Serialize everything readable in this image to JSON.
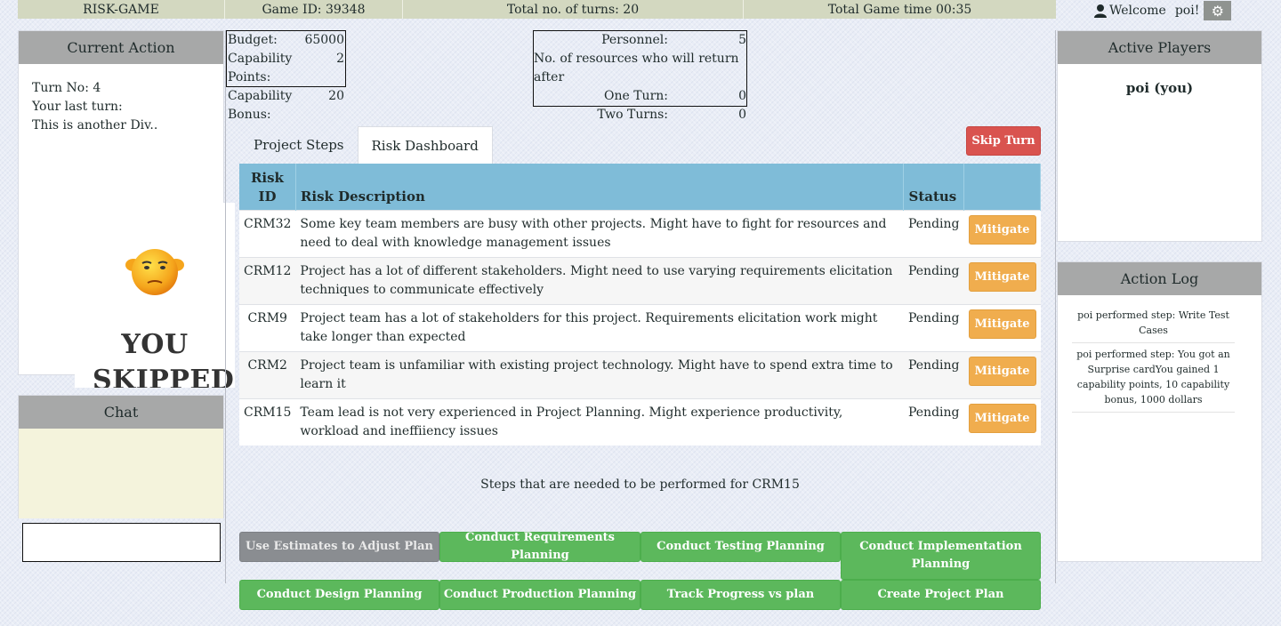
{
  "topbar": {
    "game_name": "RISK-GAME",
    "game_id": "Game ID: 39348",
    "turns": "Total no. of turns: 20",
    "time": "Total Game time 00:35"
  },
  "user": {
    "welcome": "Welcome",
    "name": "poi!"
  },
  "budget": {
    "budget_label": "Budget:",
    "budget_value": "65000",
    "cap_points_label": "Capability Points:",
    "cap_points_value": "2",
    "cap_bonus_label": "Capability Bonus:",
    "cap_bonus_value": "20"
  },
  "personnel": {
    "personnel_label": "Personnel:",
    "personnel_value": "5",
    "return_label": "No. of resources who will return after",
    "one_turn_label": "One Turn:",
    "one_turn_value": "0",
    "two_turns_label": "Two Turns:",
    "two_turns_value": "0"
  },
  "current_action": {
    "title": "Current Action",
    "turn_no": "Turn No: 4",
    "last_turn": "Your last turn:",
    "another_div": "This is another Div..",
    "skipped_line1": "YOU",
    "skipped_line2": "SKIPPED"
  },
  "chat": {
    "title": "Chat"
  },
  "tabs": {
    "project_steps": "Project Steps",
    "risk_dashboard": "Risk Dashboard",
    "skip_turn": "Skip Turn"
  },
  "table": {
    "col_id": "Risk ID",
    "col_desc": "Risk Description",
    "col_status": "Status",
    "rows": [
      {
        "id": "CRM32",
        "desc": "Some key team members are busy with other projects. Might have to fight for resources and need to deal with knowledge management issues",
        "status": "Pending",
        "action": "Mitigate"
      },
      {
        "id": "CRM12",
        "desc": "Project has a lot of different stakeholders. Might need to use varying requirements elicitation techniques to communicate effectively",
        "status": "Pending",
        "action": "Mitigate"
      },
      {
        "id": "CRM9",
        "desc": "Project team has a lot of stakeholders for this project. Requirements elicitation work might take longer than expected",
        "status": "Pending",
        "action": "Mitigate"
      },
      {
        "id": "CRM2",
        "desc": "Project team is unfamiliar with existing project technology. Might have to spend extra time to learn it",
        "status": "Pending",
        "action": "Mitigate"
      },
      {
        "id": "CRM15",
        "desc": "Team lead is not very experienced in Project Planning. Might experience productivity, workload and ineffiiency issues",
        "status": "Pending",
        "action": "Mitigate"
      }
    ]
  },
  "steps": {
    "title": "Steps that are needed to be performed for CRM15",
    "buttons": [
      "Use Estimates to Adjust Plan",
      "Conduct Requirements Planning",
      "Conduct Testing Planning",
      "Conduct Implementation Planning",
      "Conduct Design Planning",
      "Conduct Production Planning",
      "Track Progress vs plan",
      "Create Project Plan"
    ]
  },
  "active_players": {
    "title": "Active Players",
    "player": "poi (you)"
  },
  "action_log": {
    "title": "Action Log",
    "entries": [
      "poi performed step: Write Test Cases",
      "poi performed step: You got an Surprise cardYou gained 1 capability points, 10 capability bonus, 1000 dollars"
    ]
  },
  "colors": {
    "header_bar": "#d3d8c0",
    "panel_head": "#a7a8a8",
    "table_head": "#7fbcd8",
    "mitigate": "#f0ad4e",
    "skip": "#d9534f",
    "step": "#5cb85c",
    "step_disabled": "#8a8d91",
    "chat_bg": "#f4f3dc"
  },
  "icons": {
    "user": "user-icon",
    "settings": "gear-icon",
    "skipped": "shrug-smiley-icon"
  }
}
